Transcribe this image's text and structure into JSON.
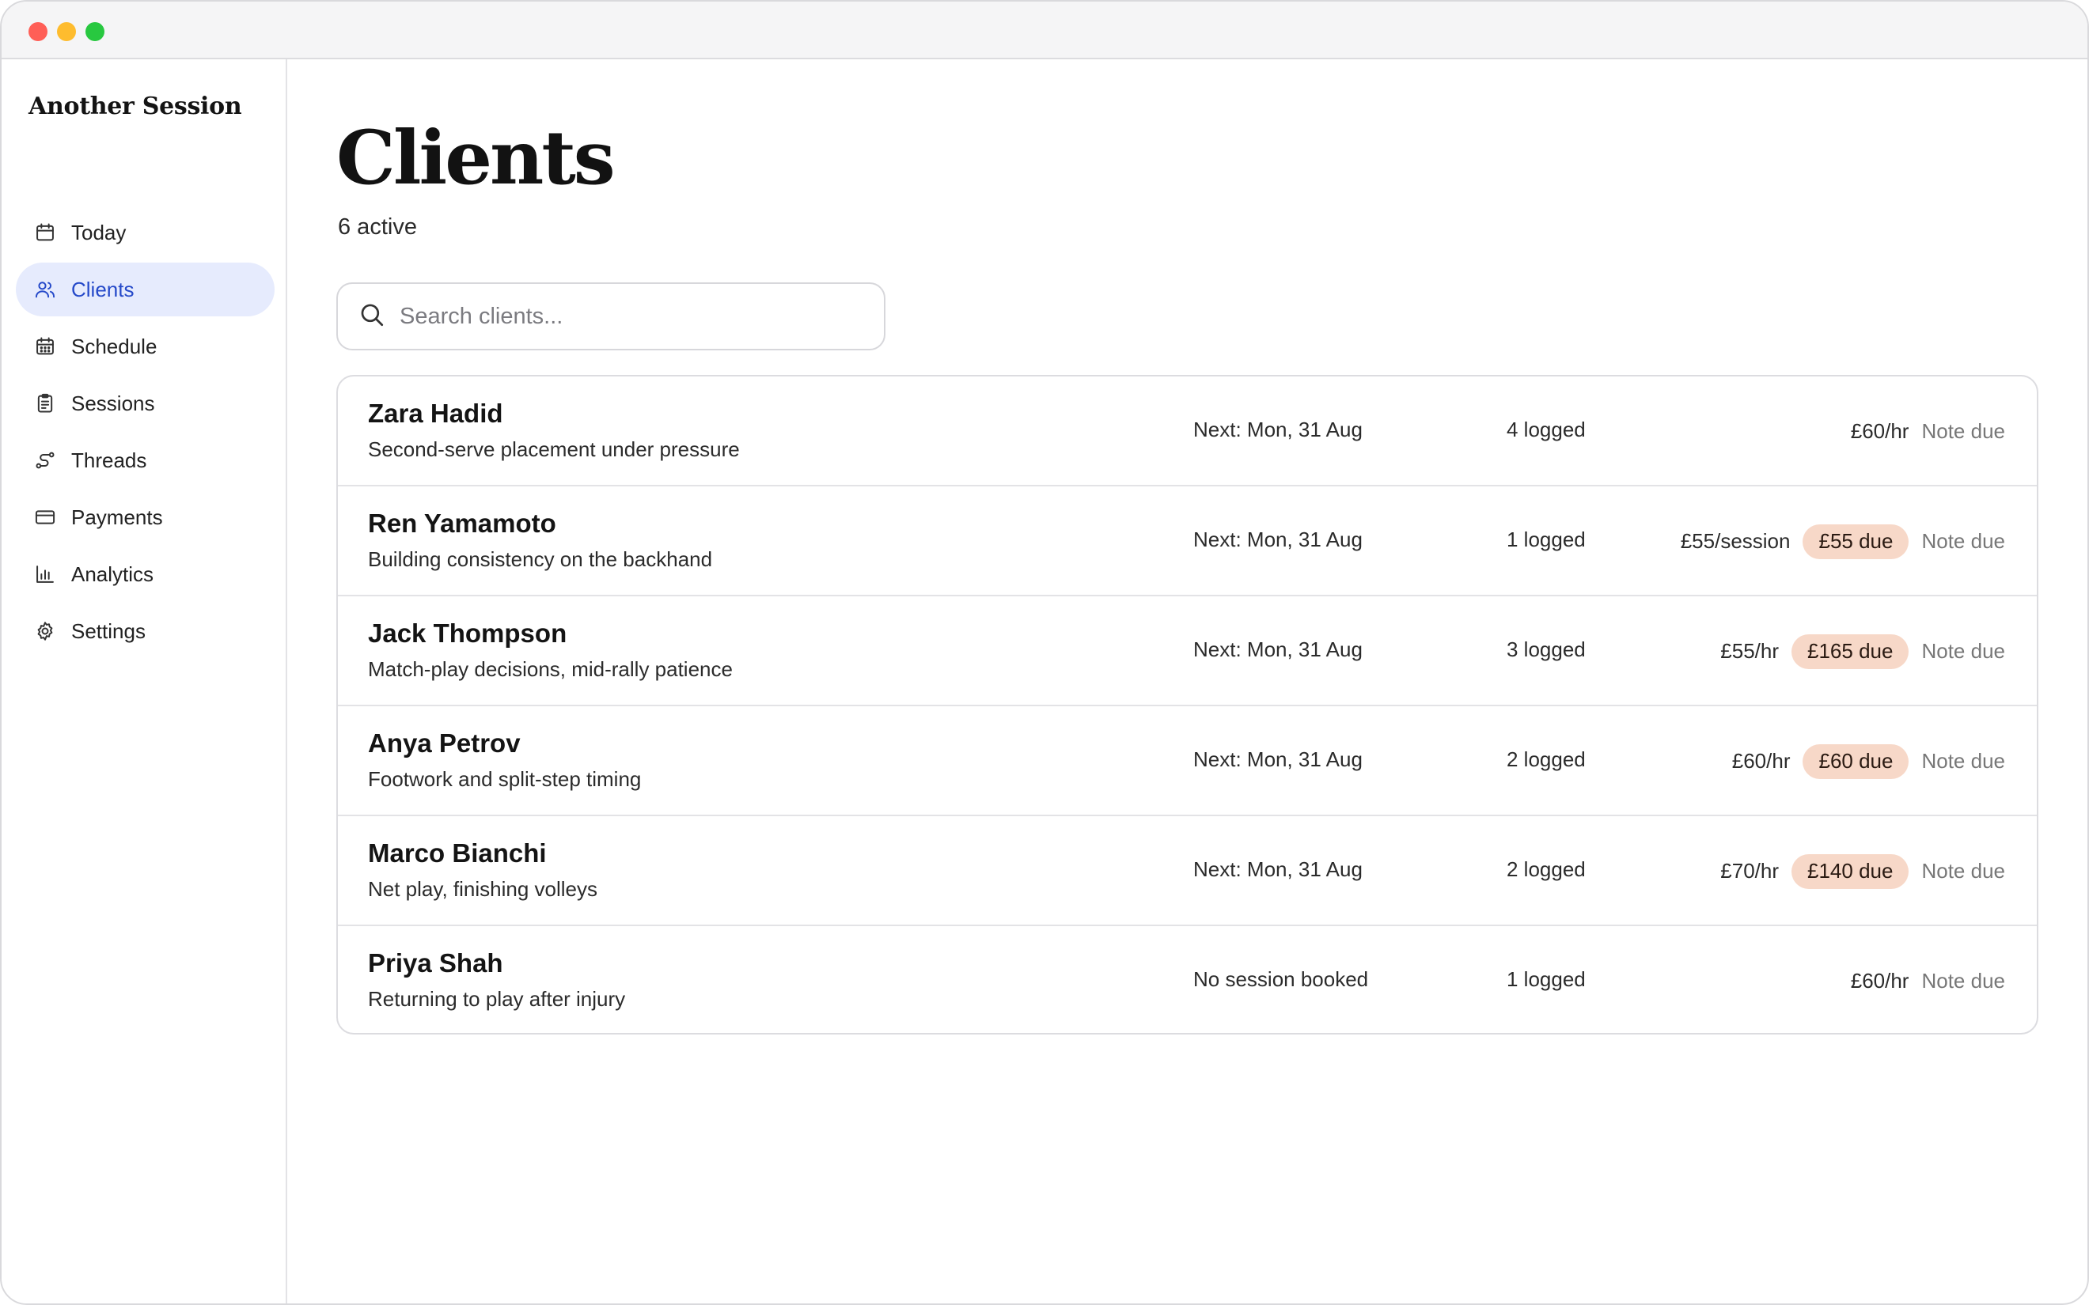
{
  "app": {
    "brand": "Another Session"
  },
  "sidebar": {
    "items": [
      {
        "label": "Today",
        "icon": "calendar-icon"
      },
      {
        "label": "Clients",
        "icon": "users-icon",
        "active": true
      },
      {
        "label": "Schedule",
        "icon": "calendar-grid-icon"
      },
      {
        "label": "Sessions",
        "icon": "clipboard-icon"
      },
      {
        "label": "Threads",
        "icon": "route-icon"
      },
      {
        "label": "Payments",
        "icon": "credit-card-icon"
      },
      {
        "label": "Analytics",
        "icon": "bar-chart-icon"
      },
      {
        "label": "Settings",
        "icon": "gear-icon"
      }
    ]
  },
  "main": {
    "title": "Clients",
    "subtitle": "6 active",
    "search": {
      "placeholder": "Search clients...",
      "value": ""
    }
  },
  "clients": [
    {
      "name": "Zara Hadid",
      "focus": "Second-serve placement under pressure",
      "next": "Next: Mon, 31 Aug",
      "logged": "4 logged",
      "rate": "£60/hr",
      "due": "",
      "note": "Note due"
    },
    {
      "name": "Ren Yamamoto",
      "focus": "Building consistency on the backhand",
      "next": "Next: Mon, 31 Aug",
      "logged": "1 logged",
      "rate": "£55/session",
      "due": "£55 due",
      "note": "Note due"
    },
    {
      "name": "Jack Thompson",
      "focus": "Match-play decisions, mid-rally patience",
      "next": "Next: Mon, 31 Aug",
      "logged": "3 logged",
      "rate": "£55/hr",
      "due": "£165 due",
      "note": "Note due"
    },
    {
      "name": "Anya Petrov",
      "focus": "Footwork and split-step timing",
      "next": "Next: Mon, 31 Aug",
      "logged": "2 logged",
      "rate": "£60/hr",
      "due": "£60 due",
      "note": "Note due"
    },
    {
      "name": "Marco Bianchi",
      "focus": "Net play, finishing volleys",
      "next": "Next: Mon, 31 Aug",
      "logged": "2 logged",
      "rate": "£70/hr",
      "due": "£140 due",
      "note": "Note due"
    },
    {
      "name": "Priya Shah",
      "focus": "Returning to play after injury",
      "next": "No session booked",
      "logged": "1 logged",
      "rate": "£60/hr",
      "due": "",
      "note": "Note due"
    }
  ],
  "colors": {
    "accent": "#2549c9",
    "active_bg": "#e6ebfd",
    "due_badge_bg": "#f7d8c8"
  }
}
